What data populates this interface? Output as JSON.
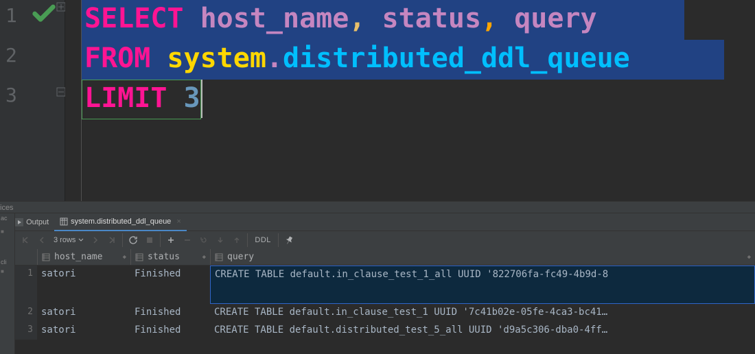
{
  "editor": {
    "lines": [
      "1",
      "2",
      "3"
    ],
    "tokens": {
      "select": "SELECT",
      "host_name": "host_name",
      "comma1": ",",
      "status": "status",
      "comma2": ",",
      "query": "query",
      "from": "FROM",
      "system": "system",
      "dot": ".",
      "table": "distributed_ddl_queue",
      "limit": "LIMIT",
      "three": "3"
    }
  },
  "panel_label": "ices",
  "tabs": {
    "output": "Output",
    "result": "system.distributed_ddl_queue"
  },
  "toolbar": {
    "row_count": "3 rows",
    "ddl": "DDL"
  },
  "grid": {
    "columns": {
      "host": "host_name",
      "status": "status",
      "query": "query"
    },
    "rows": [
      {
        "n": "1",
        "host": "satori",
        "status": "Finished",
        "query": "CREATE TABLE default.in_clause_test_1_all UUID '822706fa-fc49-4b9d-8"
      },
      {
        "n": "2",
        "host": "satori",
        "status": "Finished",
        "query": "CREATE TABLE default.in_clause_test_1 UUID '7c41b02e-05fe-4ca3-bc41…"
      },
      {
        "n": "3",
        "host": "satori",
        "status": "Finished",
        "query": "CREATE TABLE default.distributed_test_5_all UUID 'd9a5c306-dba0-4ff…"
      }
    ]
  },
  "side_labels": {
    "ac": "ac",
    "cli": "cli"
  }
}
